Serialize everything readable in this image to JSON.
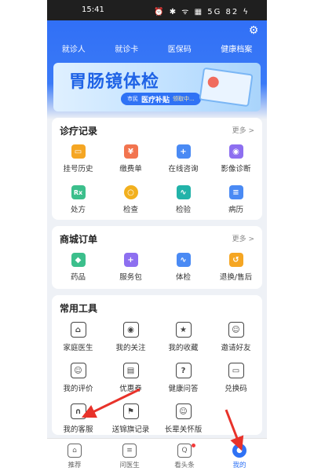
{
  "status_bar": {
    "time": "15:41",
    "icons_text": "⏰ ✱ ᯤ ▦ 5G 82 ϟ"
  },
  "top_nav": [
    "就诊人",
    "就诊卡",
    "医保码",
    "健康档案"
  ],
  "banner": {
    "title": "胃肠镜体检",
    "pill_small": "市民",
    "pill_main": "医疗补贴",
    "pill_tail": "领取中..."
  },
  "medical_records": {
    "title": "诊疗记录",
    "more": "更多 >",
    "items": [
      {
        "label": "挂号历史",
        "icon": "calendar-icon",
        "glyph": "▭"
      },
      {
        "label": "缴费单",
        "icon": "yen-bill-icon",
        "glyph": "¥"
      },
      {
        "label": "在线咨询",
        "icon": "chat-plus-icon",
        "glyph": "+"
      },
      {
        "label": "影像诊断",
        "icon": "scanner-icon",
        "glyph": "◉"
      },
      {
        "label": "处方",
        "icon": "rx-icon",
        "glyph": "Rx"
      },
      {
        "label": "检查",
        "icon": "magnifier-icon",
        "glyph": "○"
      },
      {
        "label": "检验",
        "icon": "wave-chart-icon",
        "glyph": "∿"
      },
      {
        "label": "病历",
        "icon": "clipboard-icon",
        "glyph": "≡"
      }
    ]
  },
  "mall_orders": {
    "title": "商城订单",
    "more": "更多 >",
    "items": [
      {
        "label": "药品",
        "icon": "pill-icon",
        "glyph": "◆"
      },
      {
        "label": "服务包",
        "icon": "medical-bag-icon",
        "glyph": "+"
      },
      {
        "label": "体检",
        "icon": "checkup-icon",
        "glyph": "∿"
      },
      {
        "label": "退换/售后",
        "icon": "return-box-icon",
        "glyph": "↺"
      }
    ]
  },
  "tools": {
    "title": "常用工具",
    "items": [
      {
        "label": "家庭医生",
        "icon": "family-doctor-icon",
        "glyph": "⌂"
      },
      {
        "label": "我的关注",
        "icon": "eye-card-icon",
        "glyph": "◉"
      },
      {
        "label": "我的收藏",
        "icon": "star-icon",
        "glyph": "★"
      },
      {
        "label": "邀请好友",
        "icon": "add-user-icon",
        "glyph": "☺"
      },
      {
        "label": "我的评价",
        "icon": "review-icon",
        "glyph": "☺"
      },
      {
        "label": "优惠券",
        "icon": "coupon-icon",
        "glyph": "▤"
      },
      {
        "label": "健康问答",
        "icon": "qa-icon",
        "glyph": "?"
      },
      {
        "label": "兑换码",
        "icon": "code-icon",
        "glyph": "▭"
      },
      {
        "label": "我的客服",
        "icon": "headset-icon",
        "glyph": "∩"
      },
      {
        "label": "送锦旗记录",
        "icon": "banner-flag-icon",
        "glyph": "⚑"
      },
      {
        "label": "长辈关怀版",
        "icon": "elder-care-icon",
        "glyph": "☺"
      }
    ]
  },
  "tab_bar": [
    {
      "label": "推荐",
      "icon": "home-icon",
      "glyph": "⌂"
    },
    {
      "label": "问医生",
      "icon": "message-icon",
      "glyph": "≡"
    },
    {
      "label": "看头条",
      "icon": "news-icon",
      "glyph": "Q"
    },
    {
      "label": "我的",
      "icon": "profile-icon",
      "glyph": "●"
    }
  ],
  "colors": {
    "brand_blue": "#2f72f5",
    "arrow_red": "#e8322a"
  }
}
